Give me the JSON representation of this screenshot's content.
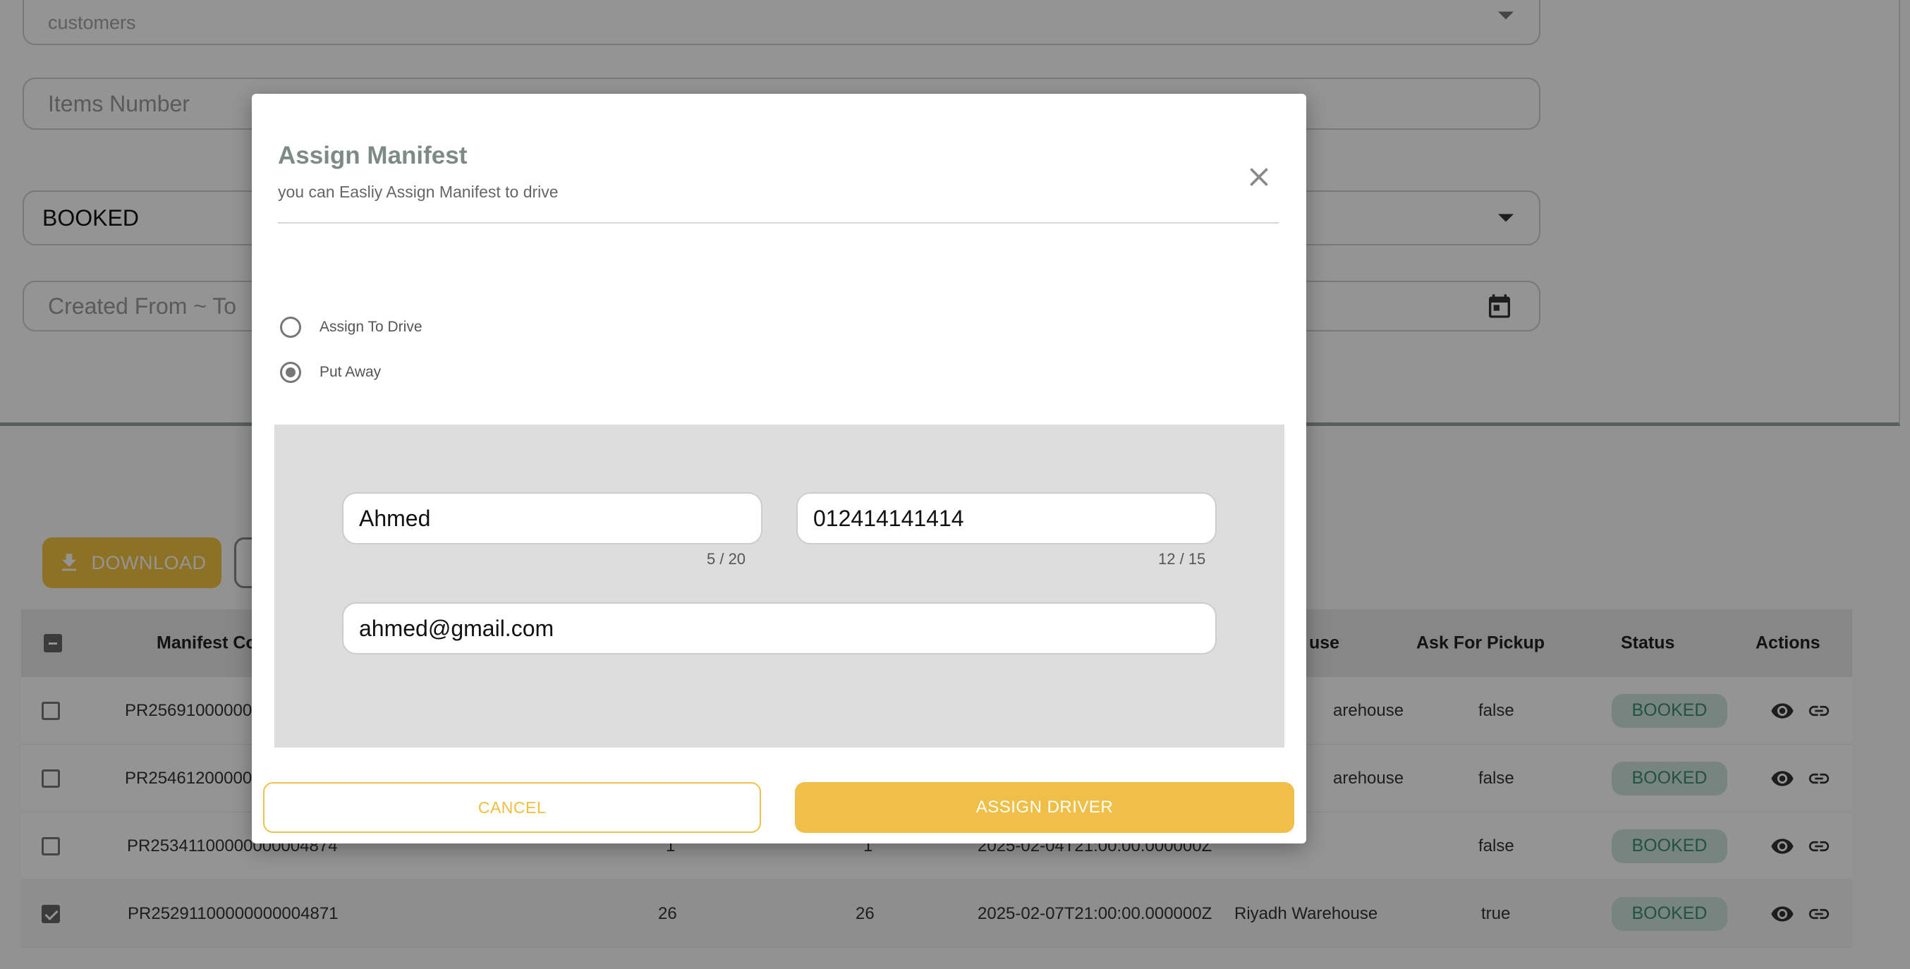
{
  "filters": {
    "customers_label": "customers",
    "items_number_placeholder": "Items Number",
    "status_value": "BOOKED",
    "created_range_placeholder": "Created From ~ To"
  },
  "toolbar": {
    "download_label": "DOWNLOAD"
  },
  "table": {
    "headers": [
      "Manifest Co",
      "use",
      "Ask For Pickup",
      "Status",
      "Actions"
    ],
    "rows": [
      {
        "code": "PR2569100000000",
        "col1": "",
        "col2": "",
        "date": "",
        "warehouse": "arehouse",
        "pickup": "false",
        "status": "BOOKED",
        "checked": false
      },
      {
        "code": "PR2546120000000",
        "col1": "",
        "col2": "",
        "date": "",
        "warehouse": "arehouse",
        "pickup": "false",
        "status": "BOOKED",
        "checked": false
      },
      {
        "code": "PR25341100000000004874",
        "col1": "1",
        "col2": "1",
        "date": "2025-02-04T21:00:00.000000Z",
        "warehouse": "",
        "pickup": "false",
        "status": "BOOKED",
        "checked": false
      },
      {
        "code": "PR25291100000000004871",
        "col1": "26",
        "col2": "26",
        "date": "2025-02-07T21:00:00.000000Z",
        "warehouse": "Riyadh Warehouse",
        "pickup": "true",
        "status": "BOOKED",
        "checked": true
      }
    ]
  },
  "modal": {
    "title": "Assign Manifest",
    "subtitle": "you can Easliy Assign Manifest to drive",
    "options": [
      {
        "label": "Assign To Drive",
        "selected": false
      },
      {
        "label": "Put Away",
        "selected": true
      }
    ],
    "form": {
      "name_value": "Ahmed",
      "name_counter": "5 / 20",
      "phone_value": "012414141414",
      "phone_counter": "12 / 15",
      "email_value": "ahmed@gmail.com"
    },
    "cancel_label": "CANCEL",
    "assign_label": "ASSIGN DRIVER"
  },
  "colors": {
    "accent": "#efbf47",
    "status_bg": "#cfe4dc",
    "status_text": "#3c8d6e",
    "title": "#7e8b84"
  },
  "icons": [
    "chevron-down-icon",
    "calendar-icon",
    "download-icon",
    "eye-icon",
    "link-icon",
    "close-icon"
  ]
}
